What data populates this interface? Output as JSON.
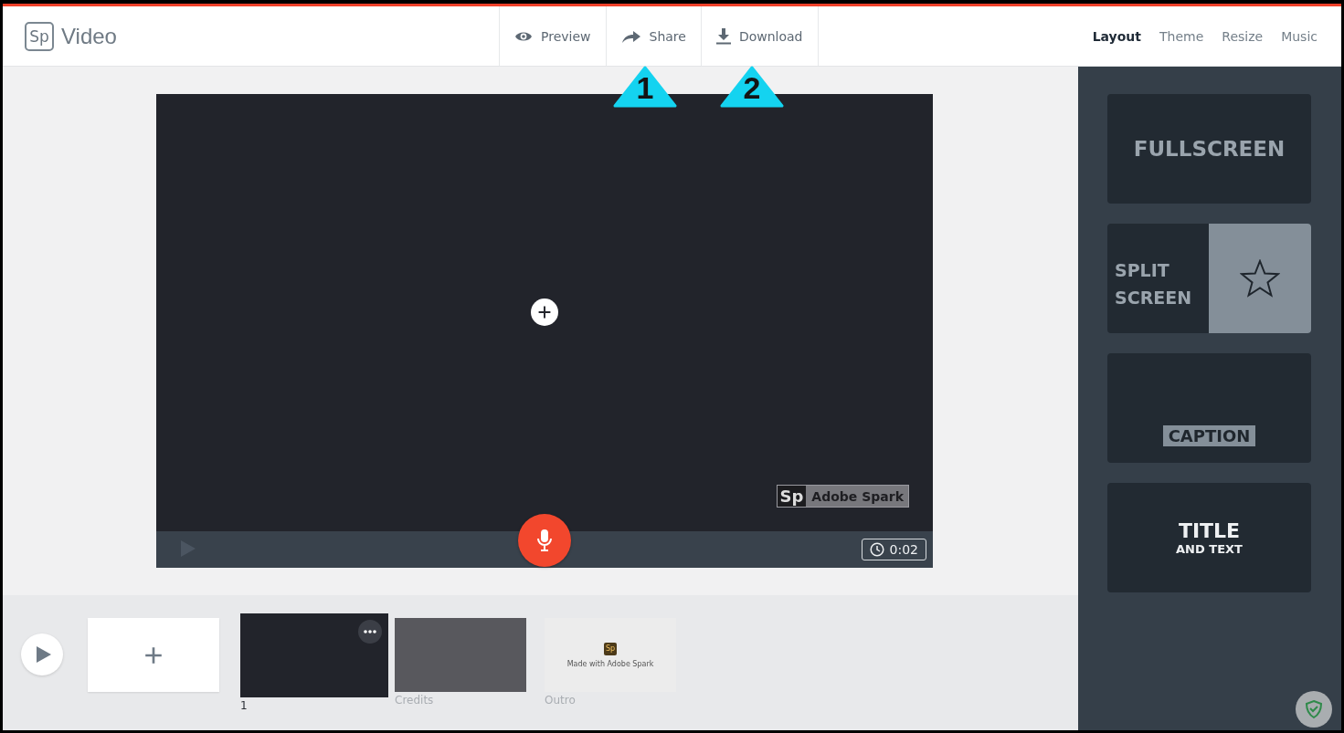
{
  "app": {
    "logo": "Sp",
    "title": "Video"
  },
  "toolbar": [
    {
      "kind": "preview",
      "label": "Preview"
    },
    {
      "kind": "share",
      "label": "Share"
    },
    {
      "kind": "download",
      "label": "Download"
    }
  ],
  "callouts": [
    {
      "label": "1"
    },
    {
      "label": "2"
    }
  ],
  "tabs": [
    {
      "label": "Layout",
      "selected": true
    },
    {
      "label": "Theme",
      "selected": false
    },
    {
      "label": "Resize",
      "selected": false
    },
    {
      "label": "Music",
      "selected": false
    }
  ],
  "stage": {
    "watermark": {
      "logo": "Sp",
      "text": "Adobe Spark"
    },
    "duration": "0:02"
  },
  "layouts": [
    {
      "kind": "fullscreen",
      "lines": [
        "FULLSCREEN"
      ]
    },
    {
      "kind": "split",
      "lines": [
        "SPLIT",
        "SCREEN"
      ]
    },
    {
      "kind": "caption",
      "lines": [
        "CAPTION"
      ]
    },
    {
      "kind": "title",
      "lines": [
        "TITLE",
        "AND TEXT"
      ]
    }
  ],
  "slides": [
    {
      "kind": "add",
      "selected": false
    },
    {
      "kind": "slide",
      "label": "1",
      "selected": true
    },
    {
      "kind": "credits",
      "label": "Credits",
      "selected": false
    },
    {
      "kind": "outro",
      "label": "Outro",
      "logo": "Sp",
      "text": "Made with Adobe Spark",
      "selected": false
    }
  ]
}
